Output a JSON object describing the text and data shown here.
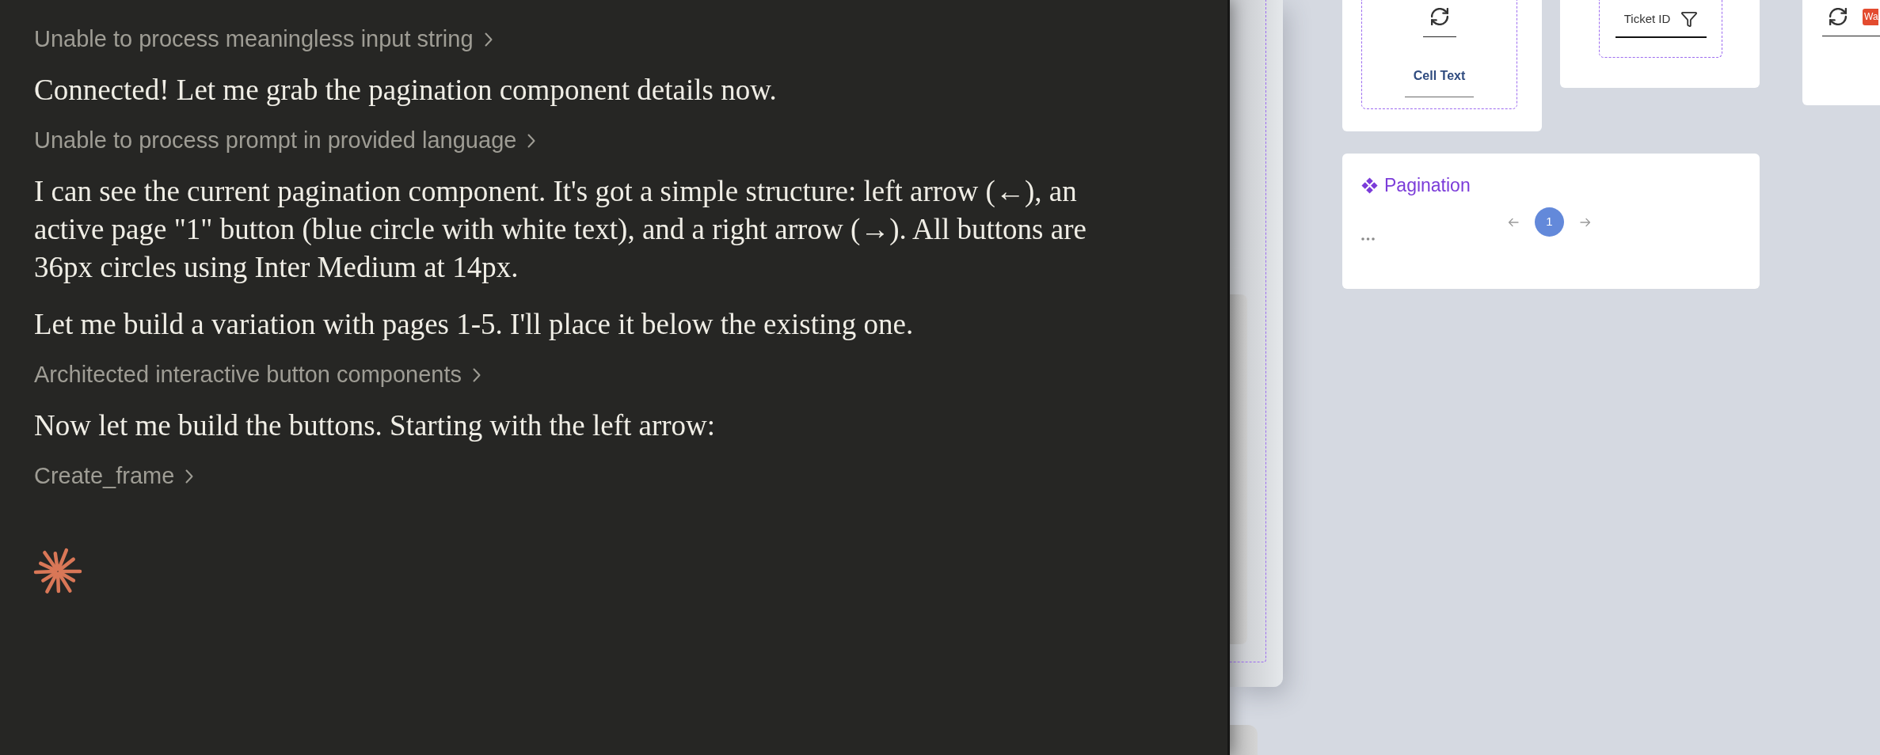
{
  "chat": {
    "items": [
      {
        "kind": "step",
        "text": "Unable to process meaningless input string"
      },
      {
        "kind": "message",
        "text": "Connected! Let me grab the pagination component details now."
      },
      {
        "kind": "step",
        "text": "Unable to process prompt in provided language"
      },
      {
        "kind": "message",
        "text": "I can see the current pagination component. It's got a simple structure: left arrow (←), an active page \"1\" button (blue circle with white text), and a right arrow (→). All buttons are 36px circles using Inter Medium at 14px."
      },
      {
        "kind": "message",
        "text": "Let me build a variation with pages 1-5. I'll place it below the existing one."
      },
      {
        "kind": "step",
        "text": "Architected interactive button components"
      },
      {
        "kind": "message",
        "text": "Now let me build the buttons. Starting with the left arrow:"
      },
      {
        "kind": "step",
        "text": "Create_frame"
      }
    ]
  },
  "canvas": {
    "cards": [
      {
        "kind": "cell",
        "label": "Cell Text"
      },
      {
        "kind": "header",
        "label": "Ticket ID"
      },
      {
        "kind": "badge",
        "badge": "Wa"
      }
    ],
    "pagination": {
      "title": "Pagination",
      "pages": [
        {
          "label": "1",
          "selected": true
        }
      ]
    }
  }
}
